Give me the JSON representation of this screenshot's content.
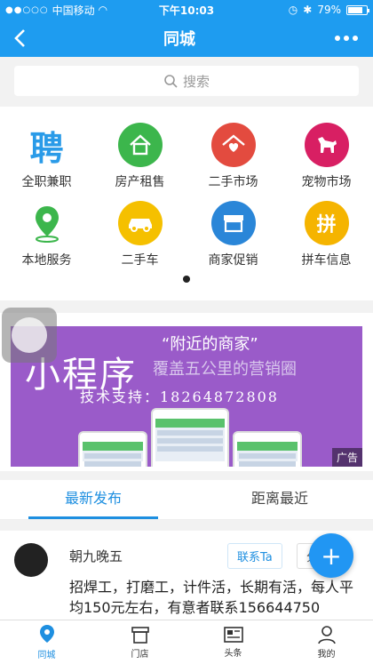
{
  "status": {
    "carrier": "中国移动",
    "time": "下午10:03",
    "battery": "79%",
    "battery_level": 0.79
  },
  "nav": {
    "title": "同城"
  },
  "search": {
    "placeholder": "搜索"
  },
  "categories": [
    {
      "label": "全职兼职",
      "icon": "job-icon",
      "color": "#2a9be8",
      "glyph": "聘"
    },
    {
      "label": "房产租售",
      "icon": "house-icon",
      "color": "#3cb64c",
      "glyph": "⌂"
    },
    {
      "label": "二手市场",
      "icon": "home-heart-icon",
      "color": "#e34b3f",
      "glyph": "⌂"
    },
    {
      "label": "宠物市场",
      "icon": "dog-icon",
      "color": "#d81f63",
      "glyph": "🐕"
    },
    {
      "label": "本地服务",
      "icon": "location-icon",
      "color": "#ffffff",
      "glyph": ""
    },
    {
      "label": "二手车",
      "icon": "car-icon",
      "color": "#f5c000",
      "glyph": ""
    },
    {
      "label": "商家促销",
      "icon": "store-icon",
      "color": "#2a86d8",
      "glyph": ""
    },
    {
      "label": "拼车信息",
      "icon": "carpool-icon",
      "color": "#f5b400",
      "glyph": "拼"
    }
  ],
  "banner": {
    "title": "小程序",
    "tagline": "“附近的商家”",
    "subtitle": "覆盖五公里的营销圈",
    "support": "技术支持：18264872808",
    "ad_label": "广告",
    "color": "#9a5bc9"
  },
  "tabs": [
    {
      "label": "最新发布",
      "active": true
    },
    {
      "label": "距离最近",
      "active": false
    }
  ],
  "post": {
    "name": "朝九晚五",
    "contact_label": "联系Ta",
    "share_label": "分",
    "text": "招焊工，打磨工，计件活，长期有活，每人平均150元左右，有意者联系156644750"
  },
  "fab": {
    "label": "+"
  },
  "tabbar": [
    {
      "label": "同城",
      "icon": "location-pin-icon",
      "active": true
    },
    {
      "label": "门店",
      "icon": "store-icon",
      "active": false
    },
    {
      "label": "头条",
      "icon": "news-icon",
      "active": false
    },
    {
      "label": "我的",
      "icon": "user-icon",
      "active": false
    }
  ],
  "colors": {
    "brand": "#1e9cf0",
    "accent": "#1e8fe0"
  }
}
